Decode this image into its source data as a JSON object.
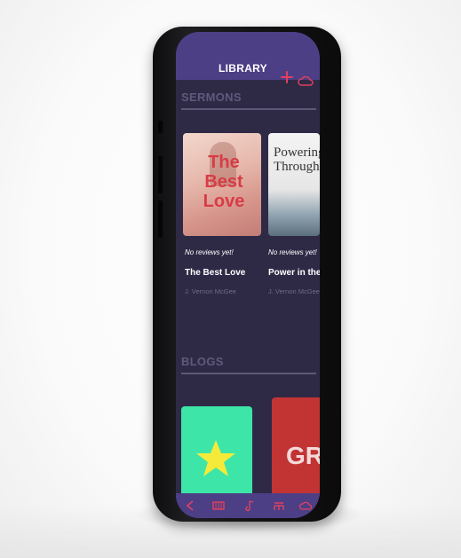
{
  "header": {
    "title": "LIBRARY",
    "add_icon": "plus-icon",
    "cloud_icon": "cloud-icon",
    "accent": "#4d3f86",
    "icon_color": "#e0415e"
  },
  "sermons": {
    "title": "SERMONS",
    "cards": [
      {
        "cover_text": "The Best Love",
        "reviews": "No reviews yet!",
        "title": "The Best Love",
        "author": "J. Vernon McGee"
      },
      {
        "cover_text": "Powering Through",
        "reviews": "No reviews yet!",
        "title": "Power in the P",
        "author": "J. Vernon McGee"
      }
    ]
  },
  "blogs": {
    "title": "BLOGS",
    "cards": [
      {
        "icon": "star-icon",
        "color": "#3de6a8"
      },
      {
        "cover_text": "GR",
        "color": "#c23434"
      }
    ]
  },
  "bottom_nav": {
    "items": [
      "back-icon",
      "library-icon",
      "music-note-icon",
      "menu-icon",
      "cloud-icon"
    ]
  }
}
